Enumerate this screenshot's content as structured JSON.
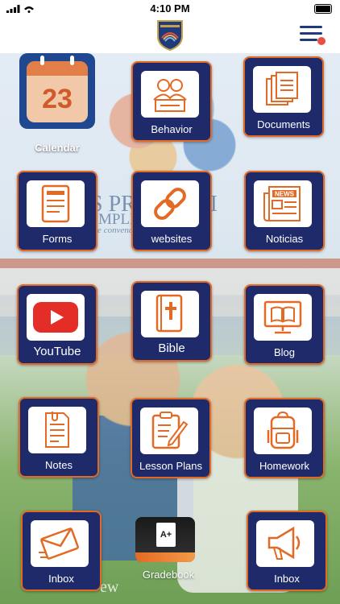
{
  "status_bar": {
    "time": "4:10 PM"
  },
  "tiles": [
    {
      "label": "Behavior",
      "icon": "behavior-icon"
    },
    {
      "label": "Documents",
      "icon": "documents-icon"
    },
    {
      "label": "Forms",
      "icon": "forms-icon"
    },
    {
      "label": "websites",
      "icon": "link-icon"
    },
    {
      "label": "Noticias",
      "icon": "news-icon"
    },
    {
      "label": "YouTube",
      "icon": "youtube-icon"
    },
    {
      "label": "Bible",
      "icon": "bible-icon"
    },
    {
      "label": "Blog",
      "icon": "blog-icon"
    },
    {
      "label": "Notes",
      "icon": "notes-icon"
    },
    {
      "label": "Lesson Plans",
      "icon": "lesson-plans-icon"
    },
    {
      "label": "Homework",
      "icon": "backpack-icon"
    },
    {
      "label": "Inbox",
      "icon": "mail-icon"
    },
    {
      "label": "Inbox",
      "icon": "megaphone-icon"
    }
  ],
  "calendar": {
    "day": "23",
    "label": "Calendar"
  },
  "gradebook": {
    "badge": "A+",
    "label": "Gradebook"
  },
  "background": {
    "banner_line1": "S PRO  DE DI",
    "banner_line2": "MPLIÉN  ANOS",
    "banner_line3": "te convencid  umplir lo qu",
    "footer_text": "ew"
  },
  "colors": {
    "tile_bg": "#1f2a6b",
    "tile_border": "#e36a25",
    "calendar_bg": "#1f4891",
    "accent": "#e85040"
  }
}
